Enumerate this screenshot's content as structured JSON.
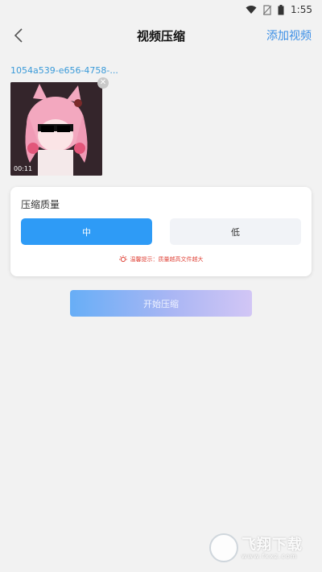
{
  "status_bar": {
    "time": "1:55"
  },
  "nav": {
    "title": "视频压缩",
    "add_label": "添加视频"
  },
  "video": {
    "file_name": "1054a539-e656-4758-...",
    "duration": "00:11"
  },
  "quality": {
    "title": "压缩质量",
    "options": [
      "中",
      "低"
    ],
    "selected": "中",
    "tip": "温馨提示：质量越高文件越大"
  },
  "actions": {
    "start_label": "开始压缩"
  },
  "watermark": {
    "text": "飞翔下载",
    "url": "www.fxxz.com"
  },
  "colors": {
    "accent": "#2e9bf6",
    "link": "#3a8ee6",
    "tip": "#e0473c"
  }
}
